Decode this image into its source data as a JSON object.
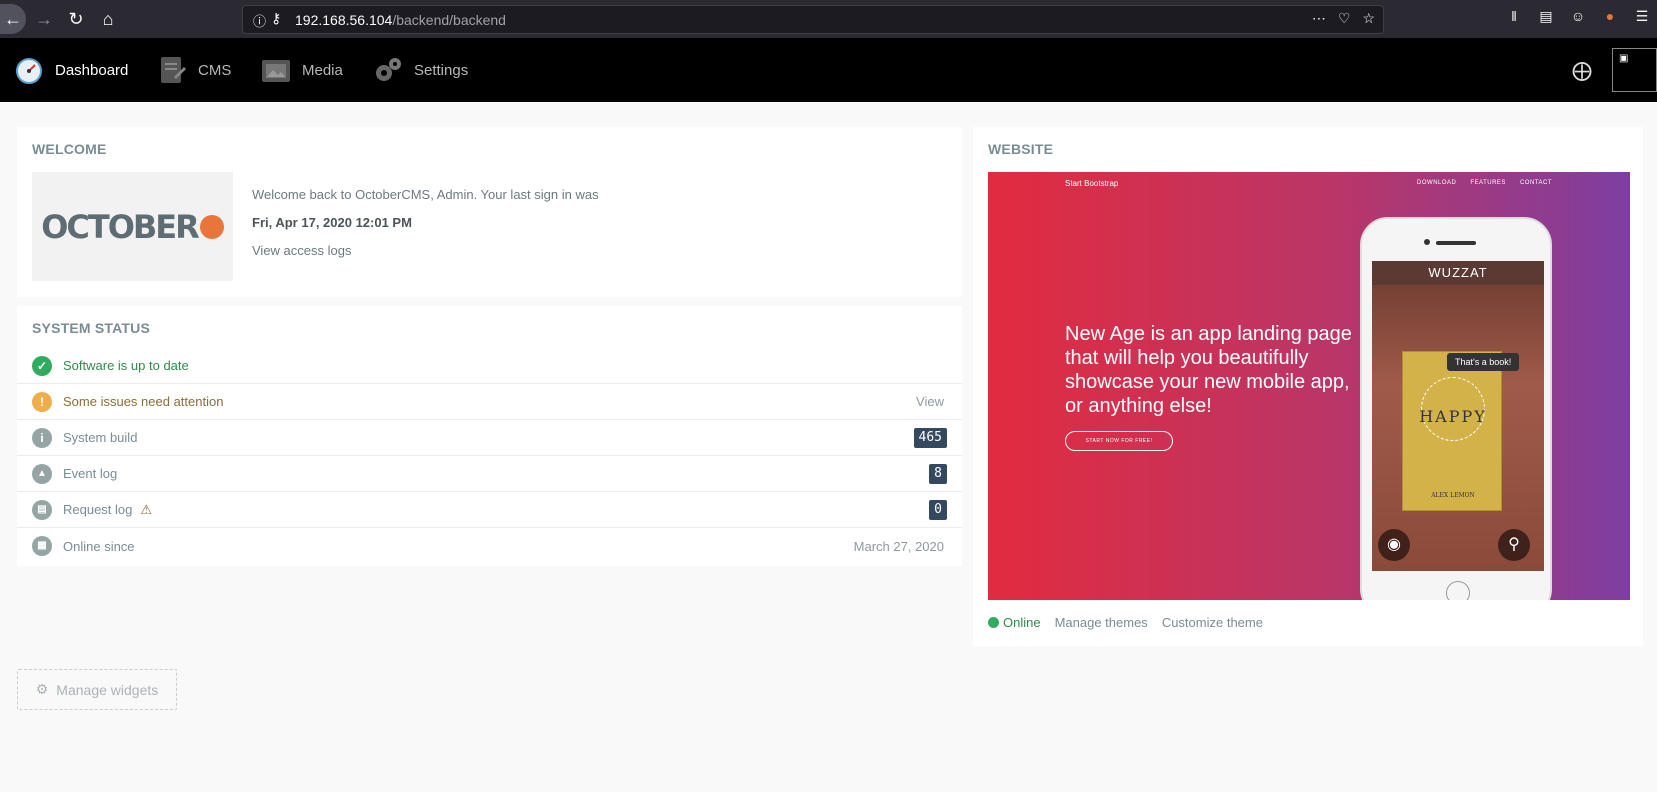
{
  "browser": {
    "url_host": "192.168.56.104",
    "url_path": "/backend/backend"
  },
  "nav": {
    "items": [
      {
        "label": "Dashboard",
        "icon": "dashboard-gauge-icon"
      },
      {
        "label": "CMS",
        "icon": "cms-icon"
      },
      {
        "label": "Media",
        "icon": "media-icon"
      },
      {
        "label": "Settings",
        "icon": "gear-icon"
      }
    ]
  },
  "welcome": {
    "title": "WELCOME",
    "message": "Welcome back to OctoberCMS, Admin. Your last sign in was",
    "last_signin": "Fri, Apr 17, 2020 12:01 PM",
    "access_logs_link": "View access logs",
    "logo_text": "OCTOBER"
  },
  "system_status": {
    "title": "SYSTEM STATUS",
    "rows": [
      {
        "label": "Software is up to date",
        "status": "success",
        "icon": "check-circle-icon"
      },
      {
        "label": "Some issues need attention",
        "status": "warning",
        "icon": "exclamation-circle-icon",
        "right": "View"
      },
      {
        "label": "System build",
        "status": "info",
        "icon": "info-circle-icon",
        "badge": "465"
      },
      {
        "label": "Event log",
        "status": "neutral",
        "icon": "warning-circle-icon",
        "badge": "8"
      },
      {
        "label": "Request log",
        "status": "neutral",
        "icon": "file-circle-icon",
        "badge": "0",
        "warning": true
      },
      {
        "label": "Online since",
        "status": "neutral",
        "icon": "calendar-circle-icon",
        "right": "March 27, 2020"
      }
    ]
  },
  "website": {
    "title": "WEBSITE",
    "preview": {
      "brand": "Start Bootstrap",
      "nav": [
        "DOWNLOAD",
        "FEATURES",
        "CONTACT"
      ],
      "headline": "New Age is an app landing page that will help you beautifully showcase your new mobile app, or anything else!",
      "cta": "START NOW FOR FREE!",
      "app_name": "WUZZAT",
      "tooltip": "That's a book!",
      "book_title": "HAPPY",
      "book_author": "ALEX LEMON"
    },
    "status": "Online",
    "manage_themes": "Manage themes",
    "customize_theme": "Customize theme"
  },
  "footer": {
    "manage_widgets": "Manage widgets"
  },
  "colors": {
    "success": "#31ac5f",
    "warning": "#f0ad4e",
    "neutral": "#95a5a6",
    "badge_bg": "#34495e",
    "header_bg": "#000000"
  }
}
